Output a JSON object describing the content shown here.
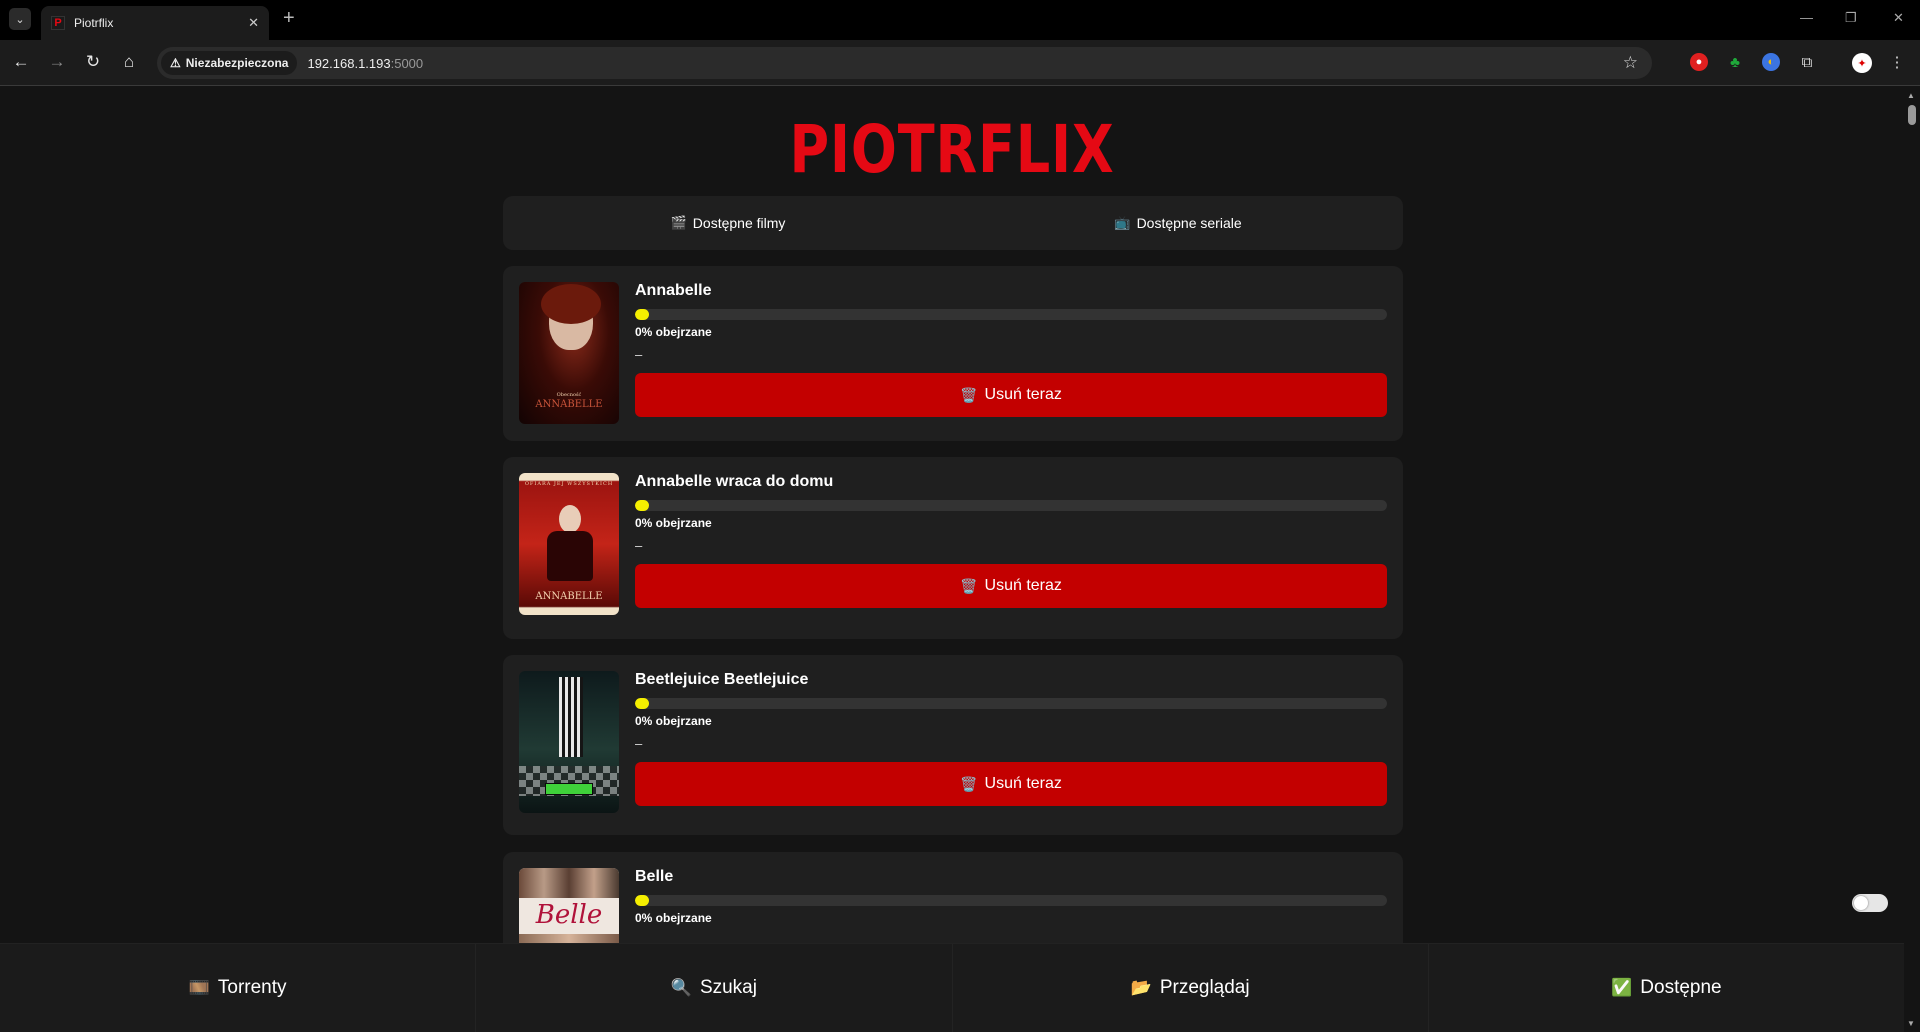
{
  "browser": {
    "tab_title": "Piotrflix",
    "tab_favicon": "P",
    "security_label": "Niezabezpieczona",
    "url_host": "192.168.1.193",
    "url_port": ":5000"
  },
  "app": {
    "logo": "PIOTRFLIX",
    "mode_tabs": [
      {
        "icon": "clapperboard-icon",
        "glyph": "🎬",
        "label": "Dostępne filmy"
      },
      {
        "icon": "tv-icon",
        "glyph": "📺",
        "label": "Dostępne seriale"
      }
    ],
    "delete_label": "Usuń teraz",
    "delete_icon": "trash-icon",
    "movies": [
      {
        "title": "Annabelle",
        "watched_percent": 0,
        "watched_label": "0% obejrzane",
        "extra": "–"
      },
      {
        "title": "Annabelle wraca do domu",
        "watched_percent": 0,
        "watched_label": "0% obejrzane",
        "extra": "–"
      },
      {
        "title": "Beetlejuice Beetlejuice",
        "watched_percent": 0,
        "watched_label": "0% obejrzane",
        "extra": "–"
      },
      {
        "title": "Belle",
        "watched_percent": 0,
        "watched_label": "0% obejrzane",
        "extra": "–"
      }
    ],
    "poster_text": {
      "annabelle_top": "Obecność",
      "annabelle_bottom": "ANNABELLE",
      "annabelle2_top": "OFIARA JEJ WSZYSTKICH",
      "annabelle2_bottom": "ANNABELLE",
      "belle": "Belle"
    },
    "bottom_nav": [
      {
        "icon": "film-frames-icon",
        "glyph": "🎞️",
        "label": "Torrenty"
      },
      {
        "icon": "magnifier-icon",
        "glyph": "🔍",
        "label": "Szukaj"
      },
      {
        "icon": "folder-icon",
        "glyph": "📂",
        "label": "Przeglądaj"
      },
      {
        "icon": "checkmark-icon",
        "glyph": "✅",
        "label": "Dostępne"
      }
    ],
    "theme_toggle_on": false
  },
  "colors": {
    "brand_red": "#e50914",
    "delete_red": "#c30000",
    "progress_yellow": "#f5ef00",
    "background": "#141414",
    "card": "#1f1f1f"
  }
}
